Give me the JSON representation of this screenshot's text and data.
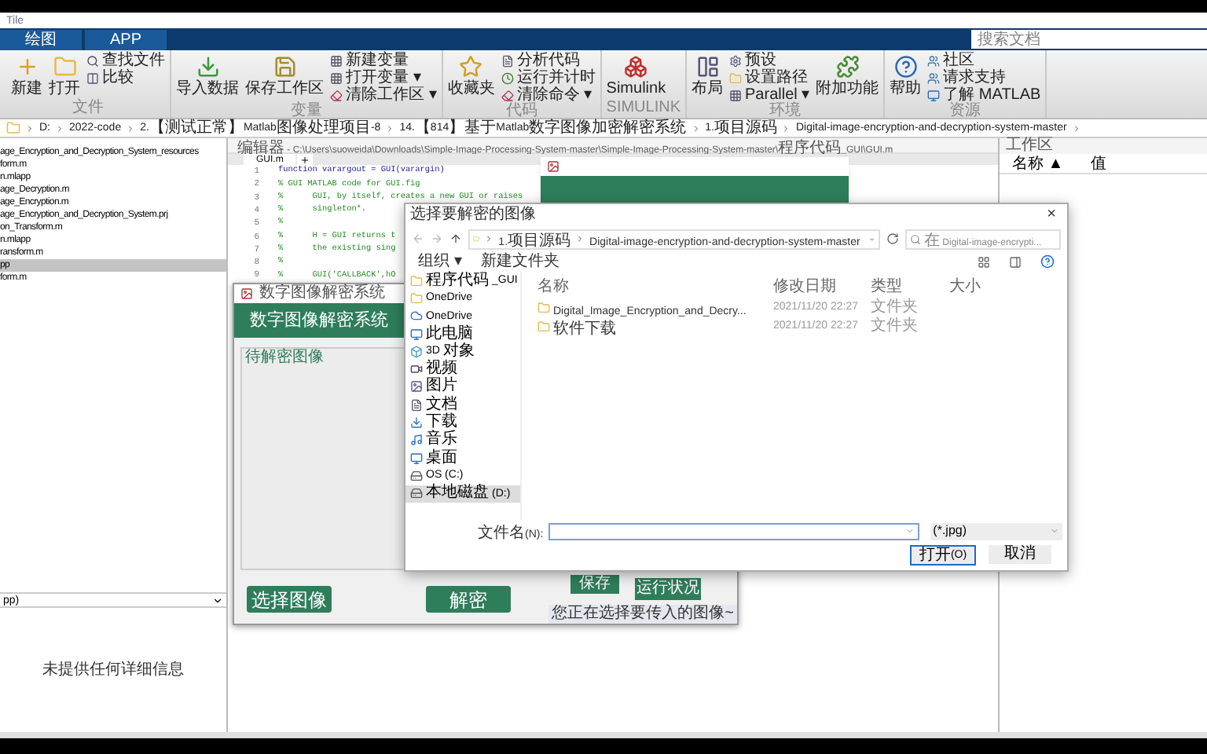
{
  "app_title": "Tile",
  "ribbon_tabs": [
    {
      "label": "绘图"
    },
    {
      "label": "APP"
    }
  ],
  "search": {
    "placeholder": "搜索文档"
  },
  "toolbar_groups": [
    {
      "label": "文件",
      "items": [
        {
          "kind": "big",
          "label": "新建"
        },
        {
          "kind": "big",
          "label": "打开"
        },
        {
          "kind": "column",
          "items": [
            {
              "label": "查找文件"
            },
            {
              "label": "比较"
            }
          ]
        }
      ]
    },
    {
      "label": "变量",
      "items": [
        {
          "kind": "big",
          "label": "导入数据"
        },
        {
          "kind": "big",
          "label": "保存工作区"
        },
        {
          "kind": "column",
          "items": [
            {
              "label": "新建变量"
            },
            {
              "label": "打开变量 ▾"
            },
            {
              "label": "清除工作区 ▾"
            }
          ]
        }
      ]
    },
    {
      "label": "代码",
      "items": [
        {
          "kind": "big",
          "label": "收藏夹"
        },
        {
          "kind": "column",
          "items": [
            {
              "label": "分析代码"
            },
            {
              "label": "运行并计时"
            },
            {
              "label": "清除命令 ▾"
            }
          ]
        }
      ]
    },
    {
      "label": "SIMULINK",
      "items": [
        {
          "kind": "big",
          "label": "Simulink"
        }
      ]
    },
    {
      "label": "环境",
      "items": [
        {
          "kind": "big",
          "label": "布局"
        },
        {
          "kind": "column",
          "items": [
            {
              "label": "预设"
            },
            {
              "label": "设置路径"
            },
            {
              "label": "Parallel ▾"
            }
          ]
        },
        {
          "kind": "big",
          "label": "附加功能"
        }
      ]
    },
    {
      "label": "资源",
      "items": [
        {
          "kind": "big",
          "label": "帮助"
        },
        {
          "kind": "column",
          "items": [
            {
              "label": "社区"
            },
            {
              "label": "请求支持"
            },
            {
              "label": "了解 MATLAB"
            }
          ]
        }
      ]
    }
  ],
  "path": [
    "D:",
    "2022-code",
    "2.【测试正常】Matlab图像处理项目-8",
    "14.【814】基于Matlab数字图像加密解密系统",
    "1.项目源码",
    "Digital-image-encryption-and-decryption-system-master"
  ],
  "files": [
    {
      "name": "age_Encryption_and_Decryption_System_resources",
      "selected": false
    },
    {
      "name": "form.m",
      "selected": false
    },
    {
      "name": "n.mlapp",
      "selected": false
    },
    {
      "name": "age_Decryption.m",
      "selected": false
    },
    {
      "name": "age_Encryption.m",
      "selected": false
    },
    {
      "name": "age_Encryption_and_Decryption_System.prj",
      "selected": false
    },
    {
      "name": "on_Transform.m",
      "selected": false
    },
    {
      "name": "n.mlapp",
      "selected": false
    },
    {
      "name": "ransform.m",
      "selected": false
    },
    {
      "name": "pp",
      "selected": true
    },
    {
      "name": "form.m",
      "selected": false
    }
  ],
  "details": {
    "selector": "pp)",
    "message": "未提供任何详细信息"
  },
  "editor": {
    "title": "编辑器 - C:\\Users\\suoweida\\Downloads\\Simple-Image-Processing-System-master\\Simple-Image-Processing-System-master\\程序代码_GUI\\GUI.m",
    "tab": "GUI.m",
    "lines": [
      {
        "number": "1",
        "code": "function varargout = GUI(varargin)"
      },
      {
        "number": "2",
        "code": "% GUI MATLAB code for GUI.fig"
      },
      {
        "number": "3",
        "code": "%      GUI, by itself, creates a new GUI or raises"
      },
      {
        "number": "4",
        "code": "%      singleton*."
      },
      {
        "number": "5",
        "code": "%"
      },
      {
        "number": "6",
        "code": "%      H = GUI returns t"
      },
      {
        "number": "7",
        "code": "%      the existing sing"
      },
      {
        "number": "8",
        "code": "%"
      },
      {
        "number": "9",
        "code": "%      GUI('CALLBACK',hO"
      }
    ]
  },
  "workspace": {
    "title": "工作区",
    "columns": [
      "名称 ▲",
      "值"
    ]
  },
  "gui_window": {
    "title": "数字图像解密系统",
    "header": "数字图像解密系统",
    "panel_label": "待解密图像",
    "buttons": [
      "选择图像",
      "解密"
    ],
    "save": "保存",
    "status_button": "运行状况",
    "status_text": "您正在选择要传入的图像~"
  },
  "file_dialog": {
    "title": "选择要解密的图像",
    "close": "×",
    "breadcrumb": [
      "1.项目源码",
      "Digital-image-encryption-and-decryption-system-master"
    ],
    "search_placeholder": "在 Digital-image-encrypti...",
    "toolbar": [
      "组织 ▾",
      "新建文件夹"
    ],
    "sidebar": [
      {
        "label": "程序代码_GUI",
        "selected": false
      },
      {
        "label": "OneDrive",
        "selected": false
      },
      {
        "label": "OneDrive",
        "selected": false
      },
      {
        "label": "此电脑",
        "selected": false
      },
      {
        "label": "3D 对象",
        "selected": false
      },
      {
        "label": "视频",
        "selected": false
      },
      {
        "label": "图片",
        "selected": false
      },
      {
        "label": "文档",
        "selected": false
      },
      {
        "label": "下载",
        "selected": false
      },
      {
        "label": "音乐",
        "selected": false
      },
      {
        "label": "桌面",
        "selected": false
      },
      {
        "label": "OS (C:)",
        "selected": false
      },
      {
        "label": "本地磁盘 (D:)",
        "selected": true
      }
    ],
    "columns": [
      "名称",
      "修改日期",
      "类型",
      "大小"
    ],
    "rows": [
      {
        "name": "Digital_Image_Encryption_and_Decry...",
        "date": "2021/11/20 22:27",
        "type": "文件夹"
      },
      {
        "name": "软件下载",
        "date": "2021/11/20 22:27",
        "type": "文件夹"
      }
    ],
    "filename_label": "文件名(N):",
    "filter": "(*.jpg)",
    "open": "打开(O)",
    "cancel": "取消"
  }
}
